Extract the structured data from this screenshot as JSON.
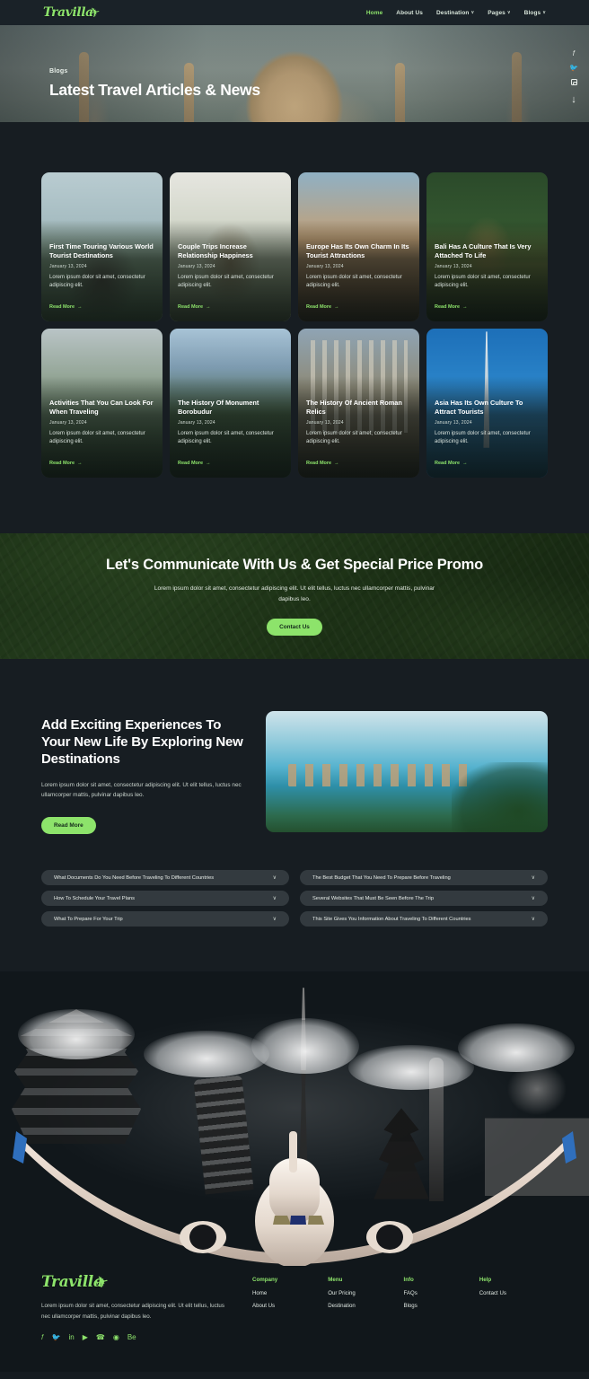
{
  "navbar": {
    "logo_text": "Travilla",
    "logo_icon": "airplane-icon",
    "links": [
      {
        "label": "Home",
        "caret": "",
        "active": true
      },
      {
        "label": "About Us",
        "caret": "",
        "active": false
      },
      {
        "label": "Destination",
        "caret": "∨",
        "active": false
      },
      {
        "label": "Pages",
        "caret": "∨",
        "active": false
      },
      {
        "label": "Blogs",
        "caret": "∨",
        "active": false
      }
    ]
  },
  "hero": {
    "breadcrumb": "Blogs",
    "title": "Latest Travel Articles & News",
    "social": [
      {
        "name": "facebook-icon",
        "glyph": "f"
      },
      {
        "name": "twitter-icon",
        "glyph": "🐦"
      },
      {
        "name": "instagram-icon",
        "glyph": ""
      }
    ],
    "scroll_arrow": "↓"
  },
  "blog": {
    "cards": [
      {
        "title": "First Time Touring Various World Tourist Destinations",
        "date": "January 13, 2024",
        "desc": "Lorem ipsum dolor sit amet, consectetur adipiscing elit.",
        "cta": "Read More",
        "cta_arrow": "→"
      },
      {
        "title": "Couple Trips Increase Relationship Happiness",
        "date": "January 13, 2024",
        "desc": "Lorem ipsum dolor sit amet, consectetur adipiscing elit.",
        "cta": "Read More",
        "cta_arrow": "→"
      },
      {
        "title": "Europe Has Its Own Charm In Its Tourist Attractions",
        "date": "January 13, 2024",
        "desc": "Lorem ipsum dolor sit amet, consectetur adipiscing elit.",
        "cta": "Read More",
        "cta_arrow": "→"
      },
      {
        "title": "Bali Has A Culture That Is Very Attached To Life",
        "date": "January 13, 2024",
        "desc": "Lorem ipsum dolor sit amet, consectetur adipiscing elit.",
        "cta": "Read More",
        "cta_arrow": "→"
      },
      {
        "title": "Activities That You Can Look For When Traveling",
        "date": "January 13, 2024",
        "desc": "Lorem ipsum dolor sit amet, consectetur adipiscing elit.",
        "cta": "Read More",
        "cta_arrow": "→"
      },
      {
        "title": "The History Of Monument Borobudur",
        "date": "January 13, 2024",
        "desc": "Lorem ipsum dolor sit amet, consectetur adipiscing elit.",
        "cta": "Read More",
        "cta_arrow": "→"
      },
      {
        "title": "The History Of Ancient Roman Relics",
        "date": "January 13, 2024",
        "desc": "Lorem ipsum dolor sit amet, consectetur adipiscing elit.",
        "cta": "Read More",
        "cta_arrow": "→"
      },
      {
        "title": "Asia Has Its Own Culture To Attract Tourists",
        "date": "January 13, 2024",
        "desc": "Lorem ipsum dolor sit amet, consectetur adipiscing elit.",
        "cta": "Read More",
        "cta_arrow": "→"
      }
    ]
  },
  "cta": {
    "title": "Let's Communicate With Us & Get Special Price Promo",
    "subtitle": "Lorem ipsum dolor sit amet, consectetur adipiscing elit. Ut elit tellus, luctus nec ullamcorper mattis, pulvinar dapibus leo.",
    "button": "Contact Us"
  },
  "experiences": {
    "title": "Add Exciting Experiences To Your New Life By Exploring New Destinations",
    "desc": "Lorem ipsum dolor sit amet, consectetur adipiscing elit. Ut elit tellus, luctus nec ullamcorper mattis, pulvinar dapibus leo.",
    "button": "Read More"
  },
  "faq": {
    "items": [
      {
        "q": "What Documents Do You Need Before Traveling To Different Countries",
        "caret": "∨"
      },
      {
        "q": "The Best Budget That You Need To Prepare Before Traveling",
        "caret": "∨"
      },
      {
        "q": "How To Schedule Your Travel Plans",
        "caret": "∨"
      },
      {
        "q": "Several Websites That Must Be Seen Before The Trip",
        "caret": "∨"
      },
      {
        "q": "What To Prepare For Your Trip",
        "caret": "∨"
      },
      {
        "q": "This Site Gives You Information About Traveling To Different Countries",
        "caret": "∨"
      }
    ]
  },
  "footer": {
    "logo_text": "Travilla",
    "desc": "Lorem ipsum dolor sit amet, consectetur adipiscing elit. Ut elit tellus, luctus nec ullamcorper mattis, pulvinar dapibus leo.",
    "social": [
      {
        "name": "facebook-icon",
        "glyph": "f"
      },
      {
        "name": "twitter-icon",
        "glyph": "🐦"
      },
      {
        "name": "linkedin-icon",
        "glyph": "in"
      },
      {
        "name": "youtube-icon",
        "glyph": "▶"
      },
      {
        "name": "whatsapp-icon",
        "glyph": "✆"
      },
      {
        "name": "instagram-icon",
        "glyph": "◎"
      },
      {
        "name": "behance-icon",
        "glyph": "Be"
      }
    ],
    "columns": [
      {
        "title": "Company",
        "links": [
          "Home",
          "About Us"
        ]
      },
      {
        "title": "Menu",
        "links": [
          "Our Pricing",
          "Destination"
        ]
      },
      {
        "title": "Info",
        "links": [
          "FAQs",
          "Blogs"
        ]
      },
      {
        "title": "Help",
        "links": [
          "Contact Us"
        ]
      }
    ]
  },
  "colors": {
    "accent_green": "#8de36b",
    "page_bg": "#171d22",
    "nav_bg": "#1a2228",
    "faq_bg": "#333a3f"
  }
}
